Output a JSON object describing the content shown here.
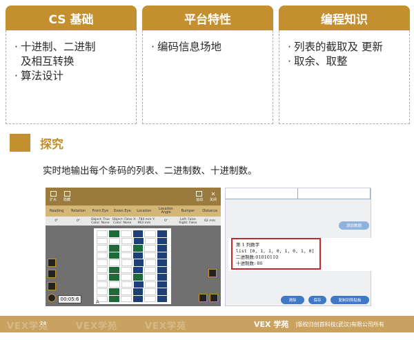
{
  "cards": [
    {
      "title": "CS 基础",
      "bullets": [
        [
          "十进制、二进制",
          "及相互转换"
        ],
        [
          "算法设计"
        ]
      ]
    },
    {
      "title": "平台特性",
      "bullets": [
        [
          "编码信息场地"
        ]
      ]
    },
    {
      "title": "编程知识",
      "bullets": [
        [
          "列表的截取及 更新"
        ],
        [
          "取余、取整"
        ]
      ]
    }
  ],
  "section": {
    "title": "探究",
    "description": "实时地输出每个条码的列表、二进制数、十进制数。"
  },
  "simulator": {
    "top_buttons": [
      "扩大",
      "隐藏",
      "运动",
      "关闭"
    ],
    "columns": [
      "Heading",
      "Rotation",
      "Front Eye",
      "Down Eye",
      "Location",
      "Location Angle",
      "Bumper",
      "Distance"
    ],
    "values": [
      "0°",
      "0°",
      "Object: True Color: None",
      "Object: False Color: None",
      "X: -784 mm Y: 963 mm",
      "0°",
      "Left: False Right: False",
      "62 mm"
    ],
    "timer": "00:05:6",
    "grid_letter": "A"
  },
  "panel": {
    "add_button": "添加数据",
    "console_lines": [
      "第 1 列数字",
      "list [0, 1, 1, 0, 1, 0, 1, 0]",
      "二进制数:01010110",
      "十进制数: 86"
    ],
    "buttons": [
      "清除",
      "保存",
      "复制到剪贴板"
    ]
  },
  "footer": {
    "page_number": "24",
    "watermark": "VEX学苑",
    "brand": "VEX 学苑",
    "copyright": "|版权归创首科技(武汉)有限公司所有"
  },
  "colors": {
    "accent": "#c38f2f",
    "footer": "#c9a262",
    "console_border": "#c4262e",
    "button": "#3e78c6"
  }
}
